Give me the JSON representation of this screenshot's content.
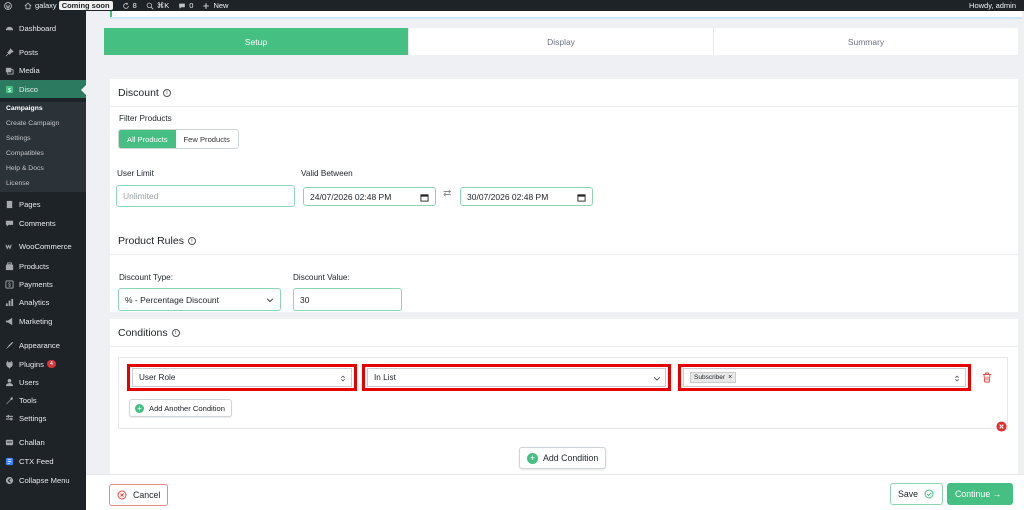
{
  "adminbar": {
    "site_name": "galaxy",
    "coming_soon": "Coming soon",
    "updates_count": "8",
    "command_shortcut": "⌘K",
    "comments_count": "0",
    "new_label": "New",
    "howdy": "Howdy, admin"
  },
  "sidebar": {
    "items": [
      {
        "label": "Dashboard",
        "icon": "dashboard-icon"
      },
      {
        "label": "Posts",
        "icon": "pin-icon"
      },
      {
        "label": "Media",
        "icon": "media-icon"
      },
      {
        "label": "Disco",
        "icon": "disco-icon"
      },
      {
        "label": "Pages",
        "icon": "pages-icon"
      },
      {
        "label": "Comments",
        "icon": "comments-icon"
      },
      {
        "label": "WooCommerce",
        "icon": "woo-icon"
      },
      {
        "label": "Products",
        "icon": "products-icon"
      },
      {
        "label": "Payments",
        "icon": "payments-icon"
      },
      {
        "label": "Analytics",
        "icon": "analytics-icon"
      },
      {
        "label": "Marketing",
        "icon": "marketing-icon"
      },
      {
        "label": "Appearance",
        "icon": "appearance-icon"
      },
      {
        "label": "Plugins",
        "icon": "plugins-icon"
      },
      {
        "label": "Users",
        "icon": "users-icon"
      },
      {
        "label": "Tools",
        "icon": "tools-icon"
      },
      {
        "label": "Settings",
        "icon": "settings-icon"
      },
      {
        "label": "Challan",
        "icon": "challan-icon"
      },
      {
        "label": "CTX Feed",
        "icon": "feed-icon"
      },
      {
        "label": "Collapse Menu",
        "icon": "collapse-icon"
      }
    ],
    "plugins_badge": "4",
    "submenu": [
      "Campaigns",
      "Create Campaign",
      "Settings",
      "Compatibles",
      "Help & Docs",
      "License"
    ]
  },
  "steps": [
    "Setup",
    "Display",
    "Summary"
  ],
  "discount": {
    "title": "Discount",
    "filter_label": "Filter Products",
    "filter_options": [
      "All Products",
      "Few Products"
    ],
    "user_limit_label": "User Limit",
    "user_limit_placeholder": "Unlimited",
    "valid_between_label": "Valid Between",
    "start_date": "24/07/2026 02:48 PM",
    "end_date": "30/07/2026 02:48 PM"
  },
  "product_rules": {
    "title": "Product Rules",
    "type_label": "Discount Type:",
    "type_value": "% - Percentage Discount",
    "value_label": "Discount Value:",
    "value": "30"
  },
  "conditions": {
    "title": "Conditions",
    "field": "User Role",
    "operator": "In List",
    "tag": "Subscriber",
    "add_another": "Add Another Condition",
    "add_condition": "Add Condition"
  },
  "footer": {
    "cancel": "Cancel",
    "save": "Save",
    "continue": "Continue →"
  },
  "colors": {
    "accent": "#45bf82",
    "highlight": "#e60000",
    "sidebar": "#1d2327",
    "active_menu": "#2c7a60"
  }
}
